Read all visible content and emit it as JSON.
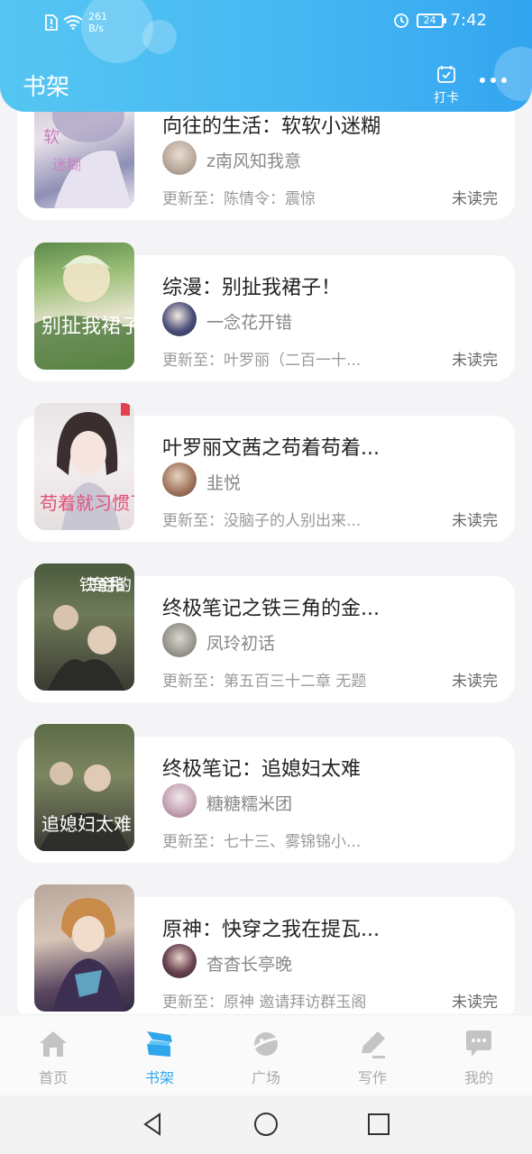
{
  "status_bar": {
    "speed": "261",
    "speed_unit": "B/s",
    "battery": "24",
    "time": "7:42"
  },
  "header": {
    "title": "书架",
    "checkin_label": "打卡"
  },
  "books": [
    {
      "title": "向往的生活：软软小迷糊",
      "author": "z南风知我意",
      "update": "更新至：陈情令：震惊",
      "status": "未读完"
    },
    {
      "title": "综漫：别扯我裙子！",
      "author": "一念花开错",
      "update": "更新至：叶罗丽（二百一十...",
      "status": "未读完"
    },
    {
      "title": "叶罗丽文茜之苟着苟着...",
      "author": "韭悦",
      "update": "更新至：没脑子的人别出来...",
      "status": "未读完"
    },
    {
      "title": "终极笔记之铁三角的金...",
      "author": "凤玲初话",
      "update": "更新至：第五百三十二章  无题",
      "status": "未读完"
    },
    {
      "title": "终极笔记：追媳妇太难",
      "author": "糖糖糯米团",
      "update": "更新至：七十三、雾锦锦小...",
      "status": ""
    },
    {
      "title": "原神：快穿之我在提瓦...",
      "author": "杳杳长亭晚",
      "update": "更新至：原神 邀请拜访群玉阁",
      "status": "未读完"
    }
  ],
  "covers": {
    "cover2_text": "别扯我裙子",
    "cover3_text": "苟着就习惯了",
    "cover4_text": "铁三角金手指的",
    "cover5_text": "追媳妇太难"
  },
  "bottom_nav": [
    {
      "label": "首页",
      "icon": "home-icon",
      "active": false
    },
    {
      "label": "书架",
      "icon": "bookshelf-icon",
      "active": true
    },
    {
      "label": "广场",
      "icon": "planet-icon",
      "active": false
    },
    {
      "label": "写作",
      "icon": "pen-icon",
      "active": false
    },
    {
      "label": "我的",
      "icon": "chat-bubble-icon",
      "active": false
    }
  ],
  "colors": {
    "accent": "#2fa6ec",
    "header_start": "#55c6f2",
    "header_end": "#33a5f0"
  }
}
